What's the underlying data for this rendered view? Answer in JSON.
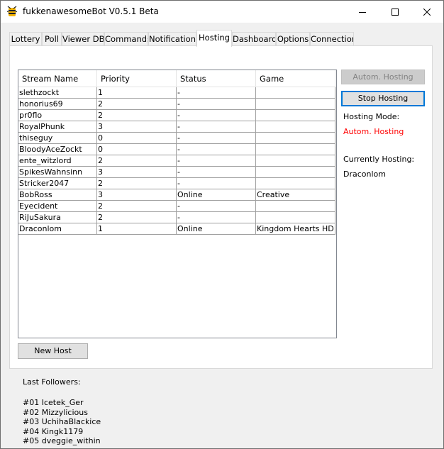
{
  "window": {
    "title": "fukkenawesomeBot V0.5.1 Beta",
    "icon": "bee-icon",
    "minimize": "minimize-icon",
    "maximize": "maximize-icon",
    "close": "close-icon"
  },
  "tabs": [
    {
      "label": "Lottery"
    },
    {
      "label": "Poll"
    },
    {
      "label": "Viewer DB"
    },
    {
      "label": "Commands"
    },
    {
      "label": "Notifications"
    },
    {
      "label": "Hosting",
      "active": true
    },
    {
      "label": "Dashboard"
    },
    {
      "label": "Options"
    },
    {
      "label": "Connection"
    }
  ],
  "table": {
    "columns": [
      "Stream Name",
      "Priority",
      "Status",
      "Game"
    ],
    "rows": [
      [
        "slethzockt",
        "1",
        "-",
        ""
      ],
      [
        "honorius69",
        "2",
        "-",
        ""
      ],
      [
        "pr0flo",
        "2",
        "-",
        ""
      ],
      [
        "RoyalPhunk",
        "3",
        "-",
        ""
      ],
      [
        "thiseguy",
        "0",
        "-",
        ""
      ],
      [
        "BloodyAceZockt",
        "0",
        "-",
        ""
      ],
      [
        "ente_witzlord",
        "2",
        "-",
        ""
      ],
      [
        "SpikesWahnsinn",
        "3",
        "-",
        ""
      ],
      [
        "Stricker2047",
        "2",
        "-",
        ""
      ],
      [
        "BobRoss",
        "3",
        "Online",
        "Creative"
      ],
      [
        "Eyecident",
        "2",
        "-",
        ""
      ],
      [
        "RiJuSakura",
        "2",
        "-",
        ""
      ],
      [
        "Draconlom",
        "1",
        "Online",
        "Kingdom Hearts HD ..."
      ]
    ]
  },
  "buttons": {
    "new_host": "New Host",
    "autom_hosting": "Autom. Hosting",
    "stop_hosting": "Stop Hosting"
  },
  "hosting": {
    "mode_label": "Hosting Mode:",
    "mode_value": "Autom. Hosting",
    "mode_color": "#ff0000",
    "current_label": "Currently Hosting:",
    "current_value": "Draconlom"
  },
  "followers": {
    "title": "Last Followers:",
    "items": [
      "#01 Icetek_Ger",
      "#02 Mizzylicious",
      "#03 UchihaBlackice",
      "#04 Kingk1179",
      "#05 dveggie_within"
    ]
  }
}
